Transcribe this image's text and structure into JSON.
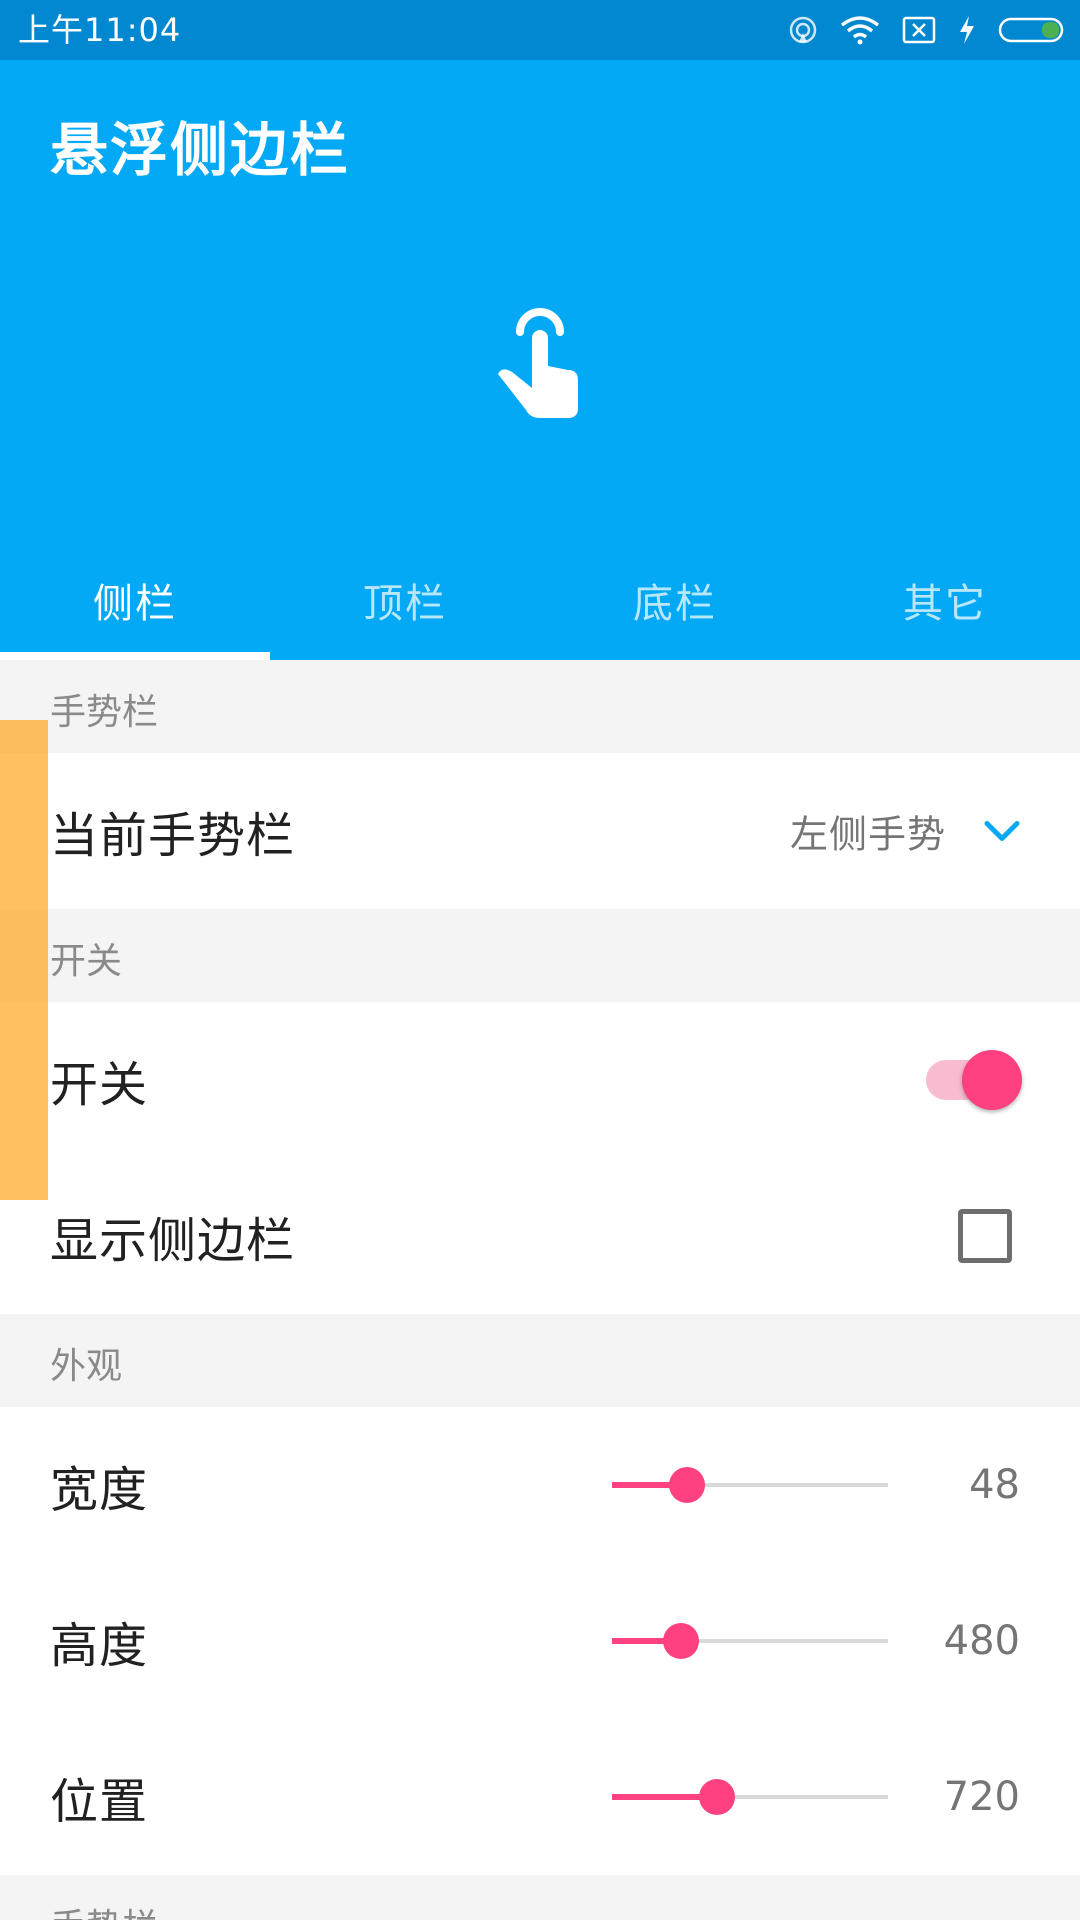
{
  "status_bar": {
    "time": "上午11:04"
  },
  "app": {
    "title": "悬浮侧边栏",
    "hero_icon": "touch-finger-icon"
  },
  "tabs": [
    {
      "label": "侧栏",
      "active": true
    },
    {
      "label": "顶栏",
      "active": false
    },
    {
      "label": "底栏",
      "active": false
    },
    {
      "label": "其它",
      "active": false
    }
  ],
  "sections": {
    "gesture": {
      "header": "手势栏",
      "current_label": "当前手势栏",
      "current_value": "左侧手势"
    },
    "switch": {
      "header": "开关",
      "toggle_label": "开关",
      "toggle_on": true,
      "show_sidebar_label": "显示侧边栏",
      "show_sidebar_checked": false
    },
    "appearance": {
      "header": "外观",
      "width": {
        "label": "宽度",
        "value": "48",
        "fraction": 0.27
      },
      "height": {
        "label": "高度",
        "value": "480",
        "fraction": 0.25
      },
      "position": {
        "label": "位置",
        "value": "720",
        "fraction": 0.38
      }
    },
    "next_header": "手势栏"
  },
  "colors": {
    "status_bar": "#0288d1",
    "primary": "#03a9f4",
    "accent": "#ff4081",
    "gesture_bar": "#ffa726"
  }
}
